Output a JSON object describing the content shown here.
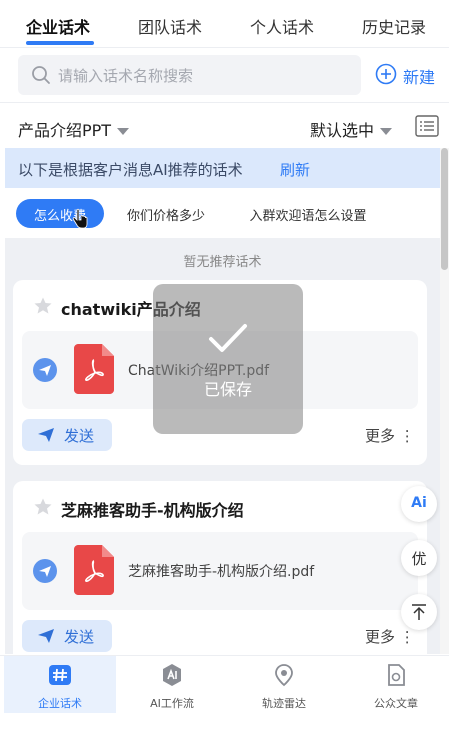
{
  "colors": {
    "accent": "#2f7bf5",
    "banner_bg": "#dbe8fc",
    "content_bg": "#eef0f4",
    "pdf_red": "#e84848"
  },
  "tabs": [
    {
      "label": "企业话术",
      "active": true
    },
    {
      "label": "团队话术",
      "active": false
    },
    {
      "label": "个人话术",
      "active": false
    },
    {
      "label": "历史记录",
      "active": false
    }
  ],
  "search": {
    "placeholder": "请输入话术名称搜索",
    "icon": "search-icon"
  },
  "new_button": {
    "label": "新建",
    "icon": "plus-circle-icon"
  },
  "filter": {
    "category": "产品介绍PPT",
    "selection": "默认选中",
    "view_icon": "list-icon"
  },
  "ai_banner": {
    "text": "以下是根据客户消息AI推荐的话术",
    "refresh": "刷新"
  },
  "chips": [
    "怎么收费",
    "你们价格多少",
    "入群欢迎语怎么设置"
  ],
  "empty_note": "暂无推荐话术",
  "cards": [
    {
      "title": "chatwiki产品介绍",
      "file": "ChatWiki介绍PPT.pdf",
      "send": "发送",
      "more": "更多 ⋮"
    },
    {
      "title": "芝麻推客助手-机构版介绍",
      "file": "芝麻推客助手-机构版介绍.pdf",
      "send": "发送",
      "more": "更多 ⋮"
    }
  ],
  "toast": {
    "label": "已保存",
    "icon": "check-icon"
  },
  "float_buttons": {
    "ai": "Ai",
    "you": "优",
    "top_icon": "arrow-up-icon"
  },
  "bottom_nav": [
    {
      "label": "企业话术",
      "icon": "hash-icon",
      "active": true
    },
    {
      "label": "AI工作流",
      "icon": "ai-workflow-icon",
      "active": false
    },
    {
      "label": "轨迹雷达",
      "icon": "location-pin-icon",
      "active": false
    },
    {
      "label": "公众文章",
      "icon": "article-icon",
      "active": false
    }
  ]
}
